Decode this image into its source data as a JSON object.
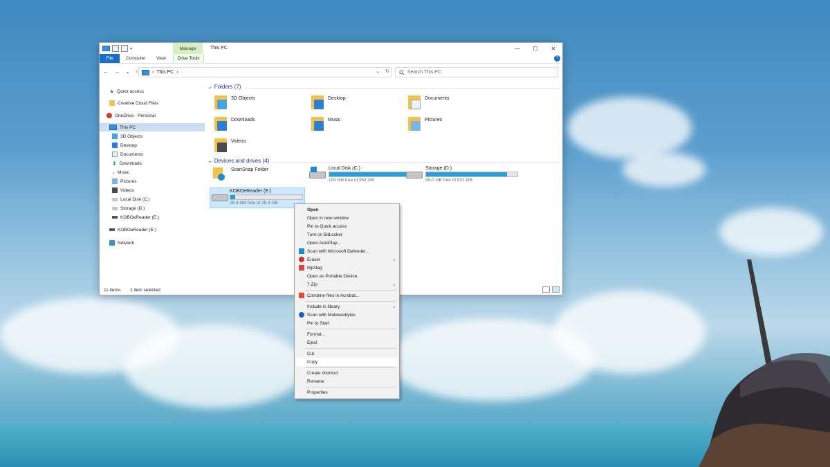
{
  "window": {
    "title": "This PC",
    "manage_tab": "Manage",
    "ribbon": {
      "file": "File",
      "computer": "Computer",
      "view": "View",
      "drive_tools": "Drive Tools"
    },
    "controls": {
      "minimize": "—",
      "maximize": "☐",
      "close": "✕",
      "help": "?"
    }
  },
  "navigation": {
    "back": "←",
    "forward": "→",
    "recent": "⌄",
    "up": "↑",
    "address": "This PC",
    "refresh": "↻",
    "search_placeholder": "Search This PC"
  },
  "sidebar": {
    "items": [
      {
        "label": "Quick access"
      },
      {
        "label": "Creative Cloud Files"
      },
      {
        "label": "OneDrive - Personal"
      },
      {
        "label": "This PC"
      },
      {
        "label": "3D Objects"
      },
      {
        "label": "Desktop"
      },
      {
        "label": "Documents"
      },
      {
        "label": "Downloads"
      },
      {
        "label": "Music"
      },
      {
        "label": "Pictures"
      },
      {
        "label": "Videos"
      },
      {
        "label": "Local Disk (C:)"
      },
      {
        "label": "Storage (D:)"
      },
      {
        "label": "KOBOeReader (E:)"
      },
      {
        "label": "KOBOeReader (E:)"
      },
      {
        "label": "Network"
      }
    ]
  },
  "folders": {
    "header": "Folders (7)",
    "items": [
      {
        "label": "3D Objects"
      },
      {
        "label": "Desktop"
      },
      {
        "label": "Documents"
      },
      {
        "label": "Downloads"
      },
      {
        "label": "Music"
      },
      {
        "label": "Pictures"
      },
      {
        "label": "Videos"
      }
    ]
  },
  "drives": {
    "header": "Devices and drives (4)",
    "items": [
      {
        "label": "ScanSnap Folder",
        "free": "",
        "used_fraction": 0
      },
      {
        "label": "Local Disk (C:)",
        "free": "100 GB free of 953 GB",
        "used_fraction": 0.9
      },
      {
        "label": "Storage (D:)",
        "free": "99.0 GB free of 931 GB",
        "used_fraction": 0.89
      },
      {
        "label": "KOBOeReader (E:)",
        "free": "26.4 GB free of 28.4 GB",
        "used_fraction": 0.07
      }
    ]
  },
  "status": {
    "items": "11 items",
    "selected": "1 item selected"
  },
  "context_menu": {
    "items": [
      {
        "label": "Open"
      },
      {
        "label": "Open in new window"
      },
      {
        "label": "Pin to Quick access"
      },
      {
        "label": "Turn on BitLocker"
      },
      {
        "label": "Open AutoPlay..."
      },
      {
        "label": "Scan with Microsoft Defender..."
      },
      {
        "label": "Eraser"
      },
      {
        "label": "Mp3tag"
      },
      {
        "label": "Open as Portable Device"
      },
      {
        "label": "7-Zip"
      },
      {
        "label": "Combine files in Acrobat..."
      },
      {
        "label": "Include in library"
      },
      {
        "label": "Scan with Malwarebytes"
      },
      {
        "label": "Pin to Start"
      },
      {
        "label": "Format..."
      },
      {
        "label": "Eject"
      },
      {
        "label": "Cut"
      },
      {
        "label": "Copy"
      },
      {
        "label": "Create shortcut"
      },
      {
        "label": "Rename"
      },
      {
        "label": "Properties"
      }
    ],
    "submenu_arrow": "›"
  }
}
